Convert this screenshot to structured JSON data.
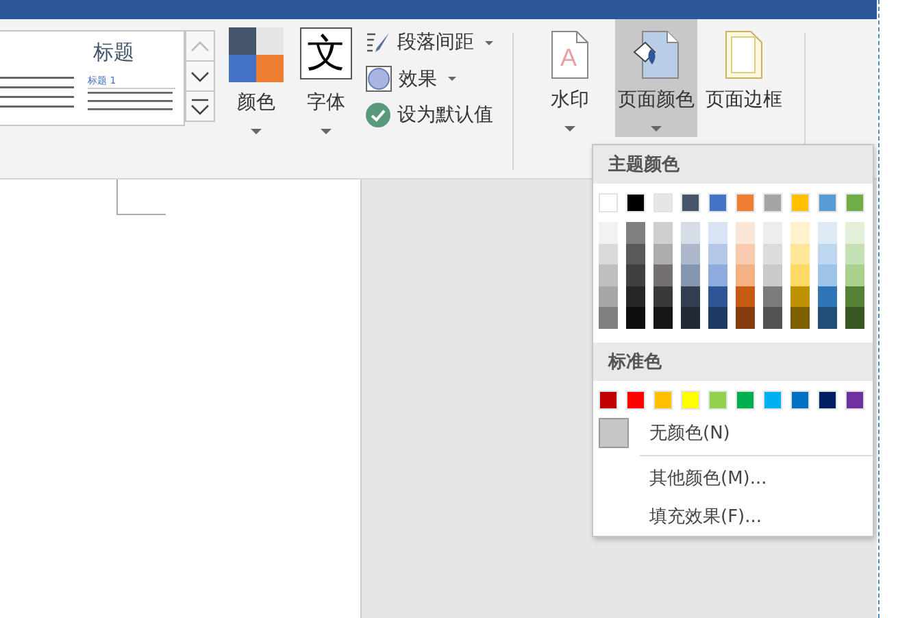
{
  "ribbon": {
    "style_gallery": {
      "title": "标题",
      "heading": "标题 1"
    },
    "buttons": [
      {
        "kind": "colors",
        "label": "颜色",
        "selected": false
      },
      {
        "kind": "fonts",
        "label": "字体",
        "glyph": "文",
        "selected": false
      }
    ],
    "options": [
      {
        "kind": "spacing",
        "label": "段落间距",
        "has_menu": true
      },
      {
        "kind": "effects",
        "label": "效果",
        "has_menu": true
      },
      {
        "kind": "default",
        "label": "设为默认值",
        "has_menu": false
      }
    ],
    "page_buttons": [
      {
        "kind": "watermark",
        "label": "水印",
        "glyph": "A",
        "selected": false,
        "has_menu": true
      },
      {
        "kind": "page_color",
        "label": "页面颜色",
        "selected": true,
        "has_menu": true
      },
      {
        "kind": "page_border",
        "label": "页面边框",
        "selected": false,
        "has_menu": false
      }
    ]
  },
  "color_menu": {
    "theme_heading": "主题颜色",
    "theme_colors": [
      {
        "color": "#ffffff",
        "shades": [
          {
            "color": "#f2f2f2"
          },
          {
            "color": "#d9d9d9"
          },
          {
            "color": "#bfbfbf"
          },
          {
            "color": "#a6a6a6"
          },
          {
            "color": "#808080"
          }
        ]
      },
      {
        "color": "#000000",
        "shades": [
          {
            "color": "#7f7f7f"
          },
          {
            "color": "#595959"
          },
          {
            "color": "#404040"
          },
          {
            "color": "#262626"
          },
          {
            "color": "#0d0d0d"
          }
        ]
      },
      {
        "color": "#e7e6e6",
        "shades": [
          {
            "color": "#d0cece"
          },
          {
            "color": "#aeabab"
          },
          {
            "color": "#757070"
          },
          {
            "color": "#3b3838"
          },
          {
            "color": "#171616"
          }
        ]
      },
      {
        "color": "#44546a",
        "shades": [
          {
            "color": "#d6dce5"
          },
          {
            "color": "#adb9ca"
          },
          {
            "color": "#8497b0"
          },
          {
            "color": "#333f50"
          },
          {
            "color": "#222a35"
          }
        ]
      },
      {
        "color": "#4472c4",
        "shades": [
          {
            "color": "#dae3f3"
          },
          {
            "color": "#b4c7e7"
          },
          {
            "color": "#8faadc"
          },
          {
            "color": "#2f5597"
          },
          {
            "color": "#203864"
          }
        ]
      },
      {
        "color": "#ed7d31",
        "shades": [
          {
            "color": "#fbe5d6"
          },
          {
            "color": "#f8cbad"
          },
          {
            "color": "#f4b183"
          },
          {
            "color": "#c55a11"
          },
          {
            "color": "#843c0c"
          }
        ]
      },
      {
        "color": "#a5a5a5",
        "shades": [
          {
            "color": "#ededed"
          },
          {
            "color": "#dbdbdb"
          },
          {
            "color": "#c9c9c9"
          },
          {
            "color": "#7b7b7b"
          },
          {
            "color": "#525252"
          }
        ]
      },
      {
        "color": "#ffc000",
        "shades": [
          {
            "color": "#fff2cc"
          },
          {
            "color": "#ffe699"
          },
          {
            "color": "#ffd966"
          },
          {
            "color": "#bf9000"
          },
          {
            "color": "#7f6000"
          }
        ]
      },
      {
        "color": "#5b9bd5",
        "shades": [
          {
            "color": "#deebf7"
          },
          {
            "color": "#bdd7ee"
          },
          {
            "color": "#9dc3e6"
          },
          {
            "color": "#2e75b6"
          },
          {
            "color": "#1f4e79"
          }
        ]
      },
      {
        "color": "#70ad47",
        "shades": [
          {
            "color": "#e2f0d9"
          },
          {
            "color": "#c5e0b4"
          },
          {
            "color": "#a9d18e"
          },
          {
            "color": "#548235"
          },
          {
            "color": "#385723"
          }
        ]
      }
    ],
    "standard_heading": "标准色",
    "standard_colors": [
      {
        "color": "#c00000"
      },
      {
        "color": "#ff0000"
      },
      {
        "color": "#ffc000"
      },
      {
        "color": "#ffff00"
      },
      {
        "color": "#92d050"
      },
      {
        "color": "#00b050"
      },
      {
        "color": "#00b0f0"
      },
      {
        "color": "#0070c0"
      },
      {
        "color": "#002060"
      },
      {
        "color": "#7030a0"
      }
    ],
    "items": [
      {
        "kind": "no_color",
        "label": "无颜色(N)"
      },
      {
        "kind": "more",
        "label": "其他颜色(M)..."
      },
      {
        "kind": "fill",
        "label": "填充效果(F)..."
      }
    ]
  }
}
